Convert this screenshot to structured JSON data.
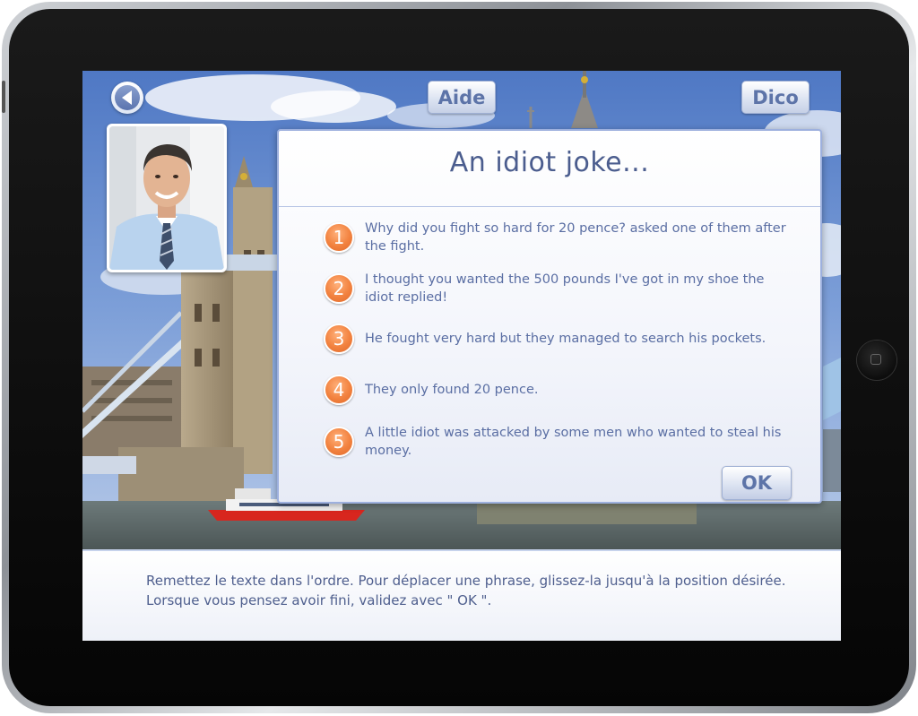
{
  "header": {
    "aide_label": "Aide",
    "dico_label": "Dico"
  },
  "dialog": {
    "title": "An idiot joke...",
    "sentences": [
      {
        "number": "1",
        "text": "Why did you fight so hard for 20 pence? asked one of them after the fight."
      },
      {
        "number": "2",
        "text": "I thought you wanted the 500 pounds I've got in my shoe the idiot replied!"
      },
      {
        "number": "3",
        "text": "He fought very hard but they managed to search his pockets."
      },
      {
        "number": "4",
        "text": "They only found 20 pence."
      },
      {
        "number": "5",
        "text": "A little idiot was attacked by some men who wanted to steal his money."
      }
    ],
    "ok_label": "OK"
  },
  "instructions": {
    "text": "Remettez le texte dans l'ordre. Pour déplacer une phrase, glissez-la jusqu'à la position désirée. Lorsque vous pensez avoir fini, validez avec \" OK \"."
  },
  "colors": {
    "accent": "#5d74a8",
    "badge": "#f2823f",
    "text": "#5a6ea3"
  }
}
